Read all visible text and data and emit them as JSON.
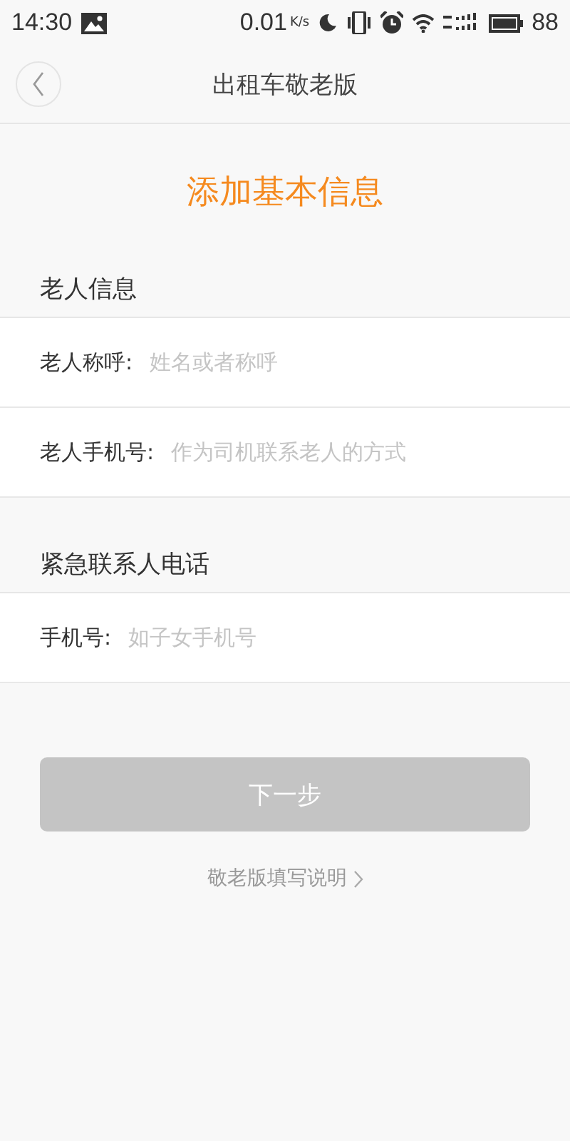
{
  "status_bar": {
    "time": "14:30",
    "speed": "0.01",
    "speed_unit": "K/s",
    "battery": "88"
  },
  "nav": {
    "title": "出租车敬老版"
  },
  "heading": "添加基本信息",
  "sections": [
    {
      "title": "老人信息",
      "fields": [
        {
          "label": "老人称呼:",
          "placeholder": "姓名或者称呼"
        },
        {
          "label": "老人手机号:",
          "placeholder": "作为司机联系老人的方式"
        }
      ]
    },
    {
      "title": "紧急联系人电话",
      "fields": [
        {
          "label": "手机号:",
          "placeholder": "如子女手机号"
        }
      ]
    }
  ],
  "next_button": {
    "label": "下一步",
    "disabled": true
  },
  "help_link": "敬老版填写说明"
}
